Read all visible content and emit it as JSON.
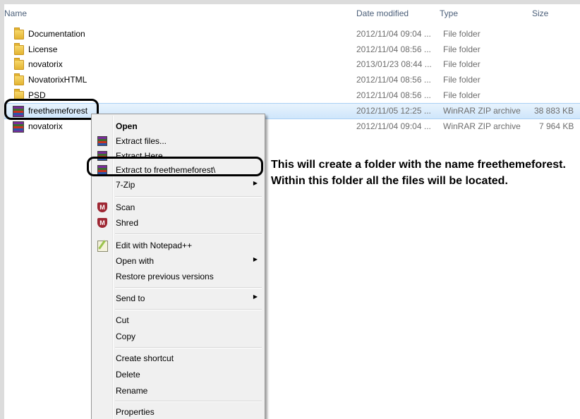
{
  "columns": {
    "name": "Name",
    "date": "Date modified",
    "type": "Type",
    "size": "Size"
  },
  "files": [
    {
      "name": "Documentation",
      "date": "2012/11/04 09:04 ...",
      "type": "File folder",
      "size": "",
      "icon": "folder-icon"
    },
    {
      "name": "License",
      "date": "2012/11/04 08:56 ...",
      "type": "File folder",
      "size": "",
      "icon": "folder-icon"
    },
    {
      "name": "novatorix",
      "date": "2013/01/23 08:44 ...",
      "type": "File folder",
      "size": "",
      "icon": "folder-icon"
    },
    {
      "name": "NovatorixHTML",
      "date": "2012/11/04 08:56 ...",
      "type": "File folder",
      "size": "",
      "icon": "folder-icon"
    },
    {
      "name": "PSD",
      "date": "2012/11/04 08:56 ...",
      "type": "File folder",
      "size": "",
      "icon": "folder-icon"
    },
    {
      "name": "freethemeforest",
      "date": "2012/11/05 12:25 ...",
      "type": "WinRAR ZIP archive",
      "size": "38 883 KB",
      "icon": "winrar-archive-icon"
    },
    {
      "name": "novatorix",
      "date": "2012/11/04 09:04 ...",
      "type": "WinRAR ZIP archive",
      "size": "7 964 KB",
      "icon": "winrar-archive-icon"
    }
  ],
  "context_menu": {
    "open": "Open",
    "extract_files": "Extract files...",
    "extract_here": "Extract Here",
    "extract_to": "Extract to freethemeforest\\",
    "seven_zip": "7-Zip",
    "scan": "Scan",
    "shred": "Shred",
    "edit_notepad": "Edit with Notepad++",
    "open_with": "Open with",
    "restore": "Restore previous versions",
    "send_to": "Send to",
    "cut": "Cut",
    "copy": "Copy",
    "create_shortcut": "Create shortcut",
    "delete": "Delete",
    "rename": "Rename",
    "properties": "Properties"
  },
  "annotation": "This will create a folder with the name freethemeforest. Within this folder all the files will be located.",
  "colors": {
    "selection": "#cfe6fb",
    "menu_bg": "#f0f0f0",
    "header_text": "#4c607a"
  }
}
